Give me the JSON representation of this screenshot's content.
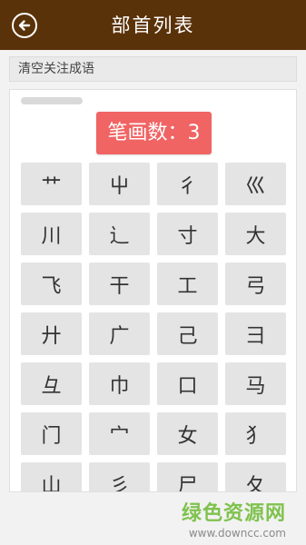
{
  "header": {
    "title": "部首列表",
    "back_icon": "arrow-left-circle-icon"
  },
  "clear_bar": {
    "label": "清空关注成语"
  },
  "stroke_badge": {
    "label": "笔画数：3"
  },
  "radicals": [
    "艹",
    "屮",
    "彳",
    "巛",
    "川",
    "辶",
    "寸",
    "大",
    "飞",
    "干",
    "工",
    "弓",
    "廾",
    "广",
    "己",
    "彐",
    "彑",
    "巾",
    "口",
    "马",
    "门",
    "宀",
    "女",
    "犭",
    "山",
    "彡",
    "尸",
    "夂"
  ],
  "watermark": {
    "main": "绿色资源网",
    "sub": "www.downcc.com"
  },
  "colors": {
    "header_bg": "#5a3209",
    "badge_bg": "#f06464",
    "watermark_green": "#7fc24e"
  }
}
